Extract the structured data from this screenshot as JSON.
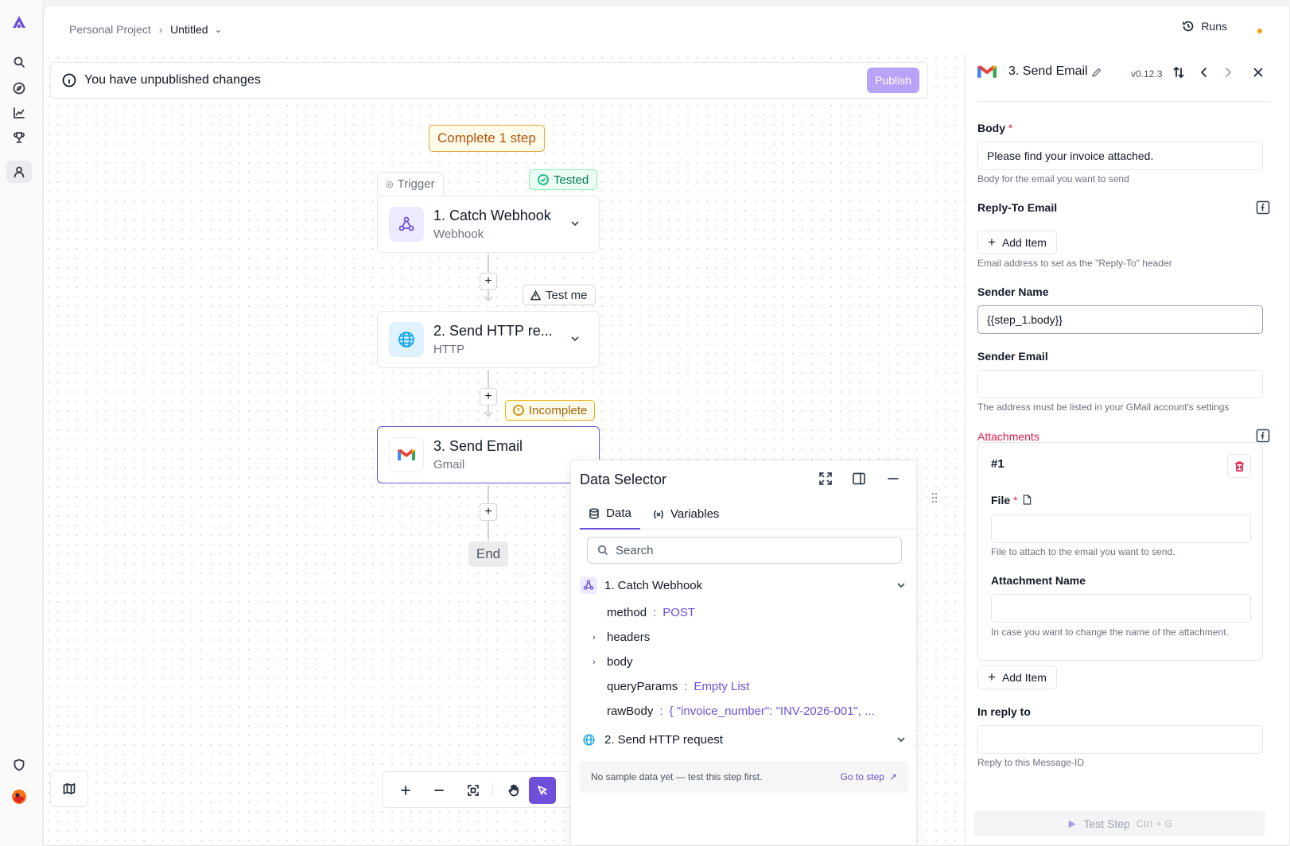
{
  "breadcrumb": {
    "project": "Personal Project",
    "flow": "Untitled"
  },
  "header": {
    "runs_label": "Runs"
  },
  "canvas": {
    "unpublished_text": "You have unpublished changes",
    "publish_label": "Publish",
    "complete_badge": "Complete 1 step",
    "trigger_tab": "Trigger",
    "tested_badge": "Tested",
    "test_me_badge": "Test me",
    "incomplete_badge": "Incomplete",
    "end_label": "End",
    "steps": [
      {
        "title": "1. Catch Webhook",
        "subtitle": "Webhook",
        "icon": "webhook-icon"
      },
      {
        "title": "2. Send HTTP re...",
        "subtitle": "HTTP",
        "icon": "globe-icon"
      },
      {
        "title": "3. Send Email",
        "subtitle": "Gmail",
        "icon": "gmail-icon"
      }
    ]
  },
  "data_selector": {
    "title": "Data Selector",
    "tabs": [
      {
        "label": "Data"
      },
      {
        "label": "Variables"
      }
    ],
    "search_placeholder": "Search",
    "groups": [
      {
        "title": "1. Catch Webhook",
        "rows": [
          {
            "key": "method",
            "value": "POST"
          },
          {
            "key": "headers"
          },
          {
            "key": "body"
          },
          {
            "key": "queryParams",
            "value": "Empty List"
          },
          {
            "key": "rawBody",
            "value": "{ \"invoice_number\": \"INV-2026-001\", ..."
          }
        ]
      },
      {
        "title": "2. Send HTTP request"
      }
    ],
    "no_sample_text": "No sample data yet — test this step first.",
    "go_to_step": "Go to step"
  },
  "panel": {
    "title": "3. Send Email",
    "version": "v0.12.3",
    "body_label": "Body",
    "required_mark": "*",
    "body_value": "Please find your invoice attached.",
    "body_hint": "Body for the email you want to send",
    "reply_to_label": "Reply-To Email",
    "add_item": "Add Item",
    "reply_to_hint": "Email address to set as the \"Reply-To\" header",
    "sender_name_label": "Sender Name",
    "sender_name_value": "{{step_1.body}}",
    "sender_email_label": "Sender Email",
    "sender_email_hint": "The address must be listed in your GMail account's settings",
    "attachments_label": "Attachments",
    "attachment_num": "#1",
    "file_label": "File",
    "file_hint": "File to attach to the email you want to send.",
    "attachment_name_label": "Attachment Name",
    "attachment_name_hint": "In case you want to change the name of the attachment.",
    "in_reply_to_label": "In reply to",
    "in_reply_to_hint": "Reply to this Message-ID",
    "test_step": "Test Step",
    "test_step_shortcut": "Ctrl + G"
  },
  "colors": {
    "accent": "#6d4fd8",
    "danger": "#e11d48",
    "warning": "#f59e0b",
    "success": "#10b981"
  }
}
